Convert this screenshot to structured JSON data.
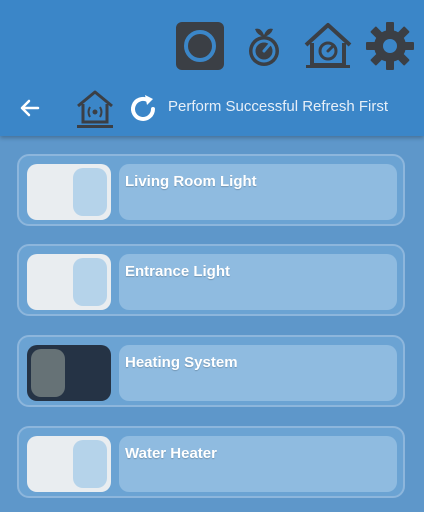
{
  "header": {
    "icons": [
      "record-icon",
      "raspberry-pi-icon",
      "home-dashboard-icon",
      "gear-icon"
    ],
    "subtitle": "Perform Successful Refresh First"
  },
  "devices": [
    {
      "name": "Living Room Light",
      "state": "off"
    },
    {
      "name": "Entrance Light",
      "state": "off"
    },
    {
      "name": "Heating System",
      "state": "on"
    },
    {
      "name": "Water Heater",
      "state": "off"
    }
  ],
  "colors": {
    "header_bg": "#3b86c8",
    "page_bg": "#5e97ca",
    "label_box": "#8fbbe0",
    "toggle_on": "#253345",
    "toggle_off": "#e9edf0"
  }
}
